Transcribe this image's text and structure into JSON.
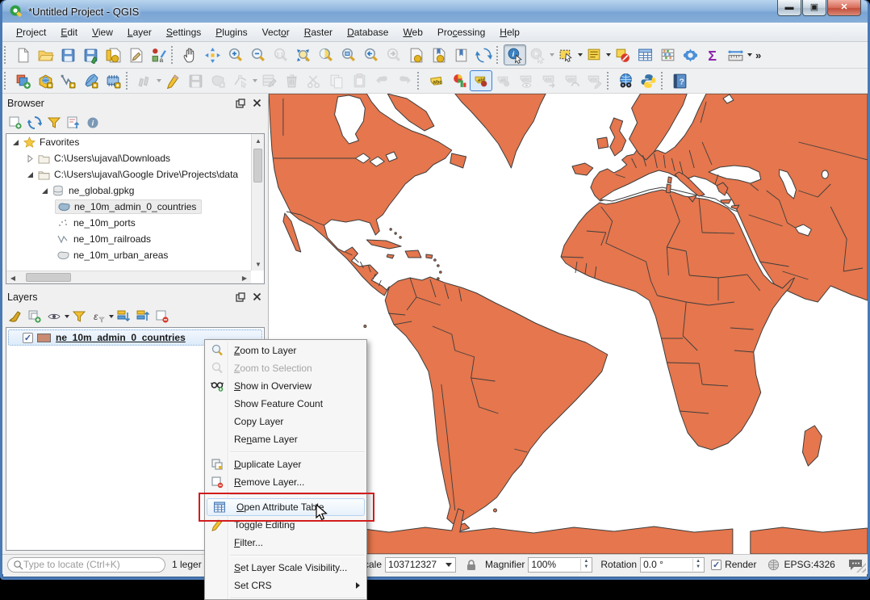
{
  "window": {
    "title": "*Untitled Project - QGIS"
  },
  "menubar": {
    "items": [
      {
        "label": "Project",
        "mnemonic": "P"
      },
      {
        "label": "Edit",
        "mnemonic": "E"
      },
      {
        "label": "View",
        "mnemonic": "V"
      },
      {
        "label": "Layer",
        "mnemonic": "L"
      },
      {
        "label": "Settings",
        "mnemonic": "S"
      },
      {
        "label": "Plugins",
        "mnemonic": "P"
      },
      {
        "label": "Vector",
        "mnemonic": "o"
      },
      {
        "label": "Raster",
        "mnemonic": "R"
      },
      {
        "label": "Database",
        "mnemonic": "D"
      },
      {
        "label": "Web",
        "mnemonic": "W"
      },
      {
        "label": "Processing",
        "mnemonic": "c"
      },
      {
        "label": "Help",
        "mnemonic": "H"
      }
    ]
  },
  "toolbars": {
    "row1": [
      "new-project",
      "open-project",
      "save-project",
      "save-project-as",
      "new-print-layout",
      "show-layout-manager",
      "style-manager",
      "pan-map",
      "pan-to-selection",
      "zoom-in",
      "zoom-out",
      "zoom-native",
      "zoom-full",
      "zoom-to-selection",
      "zoom-to-layer",
      "zoom-last",
      "zoom-next",
      "new-map-view",
      "new-3d-map-view",
      "show-bookmarks",
      "refresh",
      "identify-features",
      "run-feature-action",
      "select-features",
      "select-features-by-value",
      "deselect-features",
      "open-attribute-table",
      "field-calculator",
      "processing-toolbox",
      "statistical-summary",
      "measure-line"
    ],
    "row2": [
      "open-data-source-manager",
      "new-geopackage-layer",
      "new-shapefile-layer",
      "new-spatialite-layer",
      "new-virtual-layer",
      "current-edits",
      "toggle-editing",
      "save-layer-edits",
      "add-feature",
      "vertex-tool",
      "modify-attributes",
      "delete-selected",
      "cut-features",
      "copy-features",
      "paste-features",
      "undo",
      "redo",
      "layer-labeling",
      "layer-diagram",
      "highlight-pinned-labels",
      "pin-unpin-labels",
      "show-hide-labels",
      "move-label",
      "rotate-label",
      "change-label",
      "metasearch",
      "python-console",
      "help"
    ]
  },
  "browser": {
    "title": "Browser",
    "toolbar": [
      "add-selected-layers",
      "refresh",
      "filter-browser",
      "collapse-all",
      "properties"
    ],
    "tree": [
      {
        "label": "Favorites",
        "icon": "star",
        "state": "expanded"
      },
      {
        "label": "C:\\Users\\ujaval\\Downloads",
        "icon": "folder",
        "state": "collapsed"
      },
      {
        "label": "C:\\Users\\ujaval\\Google Drive\\Projects\\data",
        "icon": "folder",
        "state": "expanded"
      },
      {
        "label": "ne_global.gpkg",
        "icon": "database",
        "state": "expanded"
      },
      {
        "label": "ne_10m_admin_0_countries",
        "icon": "polygon-layer",
        "selected": true
      },
      {
        "label": "ne_10m_ports",
        "icon": "point-layer"
      },
      {
        "label": "ne_10m_railroads",
        "icon": "line-layer"
      },
      {
        "label": "ne_10m_urban_areas",
        "icon": "polygon-layer-gray"
      }
    ]
  },
  "layers": {
    "title": "Layers",
    "toolbar": [
      "open-layer-styling",
      "add-group",
      "manage-map-themes",
      "filter-legend",
      "filter-by-expression",
      "expand-all",
      "collapse-all",
      "remove-layer-group"
    ],
    "items": [
      {
        "label": "ne_10m_admin_0_countries",
        "checked": true,
        "swatch_color": "#c98b72"
      }
    ]
  },
  "context_menu": {
    "items": [
      {
        "label": "Zoom to Layer",
        "mnemonic": "Z",
        "icon": "zoom-to-layer"
      },
      {
        "label": "Zoom to Selection",
        "mnemonic": "Z",
        "icon": "zoom-to-selection",
        "disabled": true
      },
      {
        "label": "Show in Overview",
        "mnemonic": "S",
        "icon": "show-in-overview"
      },
      {
        "label": "Show Feature Count"
      },
      {
        "label": "Copy Layer"
      },
      {
        "label": "Rename Layer",
        "mnemonic": "n"
      },
      {
        "separator": true
      },
      {
        "label": "Duplicate Layer",
        "mnemonic": "D",
        "icon": "duplicate-layer"
      },
      {
        "label": "Remove Layer...",
        "mnemonic": "R",
        "icon": "remove-layer"
      },
      {
        "separator": true
      },
      {
        "label": "Open Attribute Table",
        "mnemonic": "O",
        "icon": "attribute-table",
        "highlighted": true
      },
      {
        "label": "Toggle Editing",
        "icon": "toggle-editing"
      },
      {
        "label": "Filter...",
        "mnemonic": "F"
      },
      {
        "separator": true
      },
      {
        "label": "Set Layer Scale Visibility...",
        "mnemonic": "S"
      },
      {
        "label": "Set CRS",
        "submenu": true
      }
    ]
  },
  "statusbar": {
    "locate_placeholder": "Type to locate (Ctrl+K)",
    "legend_text": "1 leger",
    "scale_label": "Scale",
    "scale_value": "103712327",
    "magnifier_label": "Magnifier",
    "magnifier_value": "100%",
    "rotation_label": "Rotation",
    "rotation_value": "0.0 °",
    "render_label": "Render",
    "crs": "EPSG:4326"
  },
  "map": {
    "land_color": "#e5764d",
    "stroke_color": "#3d3d3d",
    "ocean_color": "#ffffff"
  }
}
